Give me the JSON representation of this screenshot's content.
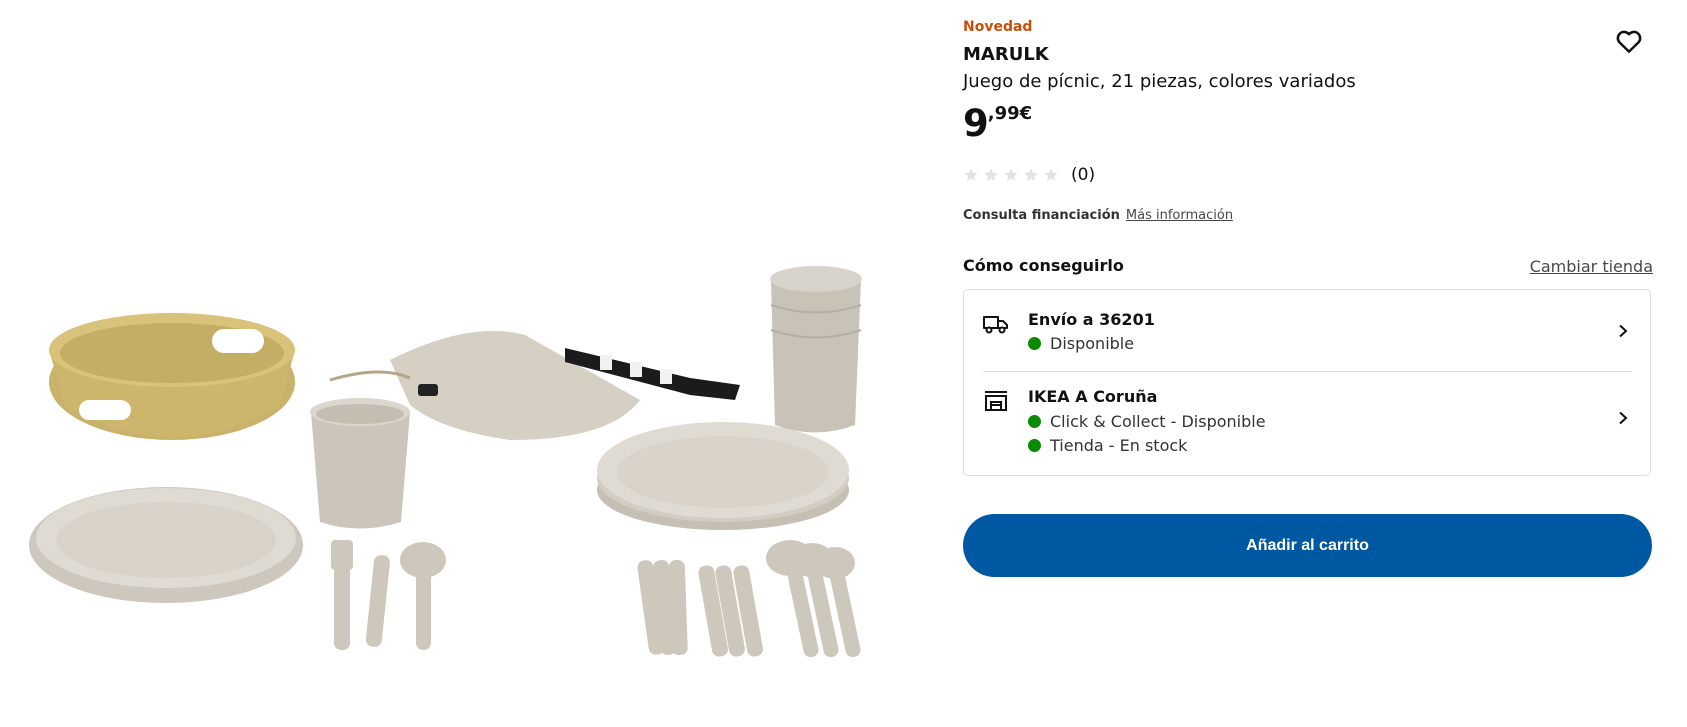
{
  "product": {
    "badge": "Novedad",
    "name": "MARULK",
    "description": "Juego de pícnic, 21 piezas, colores variados",
    "price_integer": "9",
    "price_decimal": ",99€",
    "rating_count": "(0)",
    "rating_value": 0,
    "rating_max": 5
  },
  "finance": {
    "label": "Consulta financiación",
    "link": "Más información"
  },
  "availability": {
    "heading": "Cómo conseguirlo",
    "change_store": "Cambiar tienda",
    "delivery": {
      "title": "Envío a 36201",
      "status": "Disponible",
      "icon": "truck-icon"
    },
    "store": {
      "title": "IKEA A Coruña",
      "status_collect": "Click & Collect - Disponible",
      "status_stock": "Tienda - En stock",
      "icon": "store-icon"
    },
    "status_color": "#0a8a00"
  },
  "actions": {
    "add_to_cart": "Añadir al carrito"
  },
  "colors": {
    "badge": "#ca5008",
    "primary_button": "#0058a3"
  }
}
